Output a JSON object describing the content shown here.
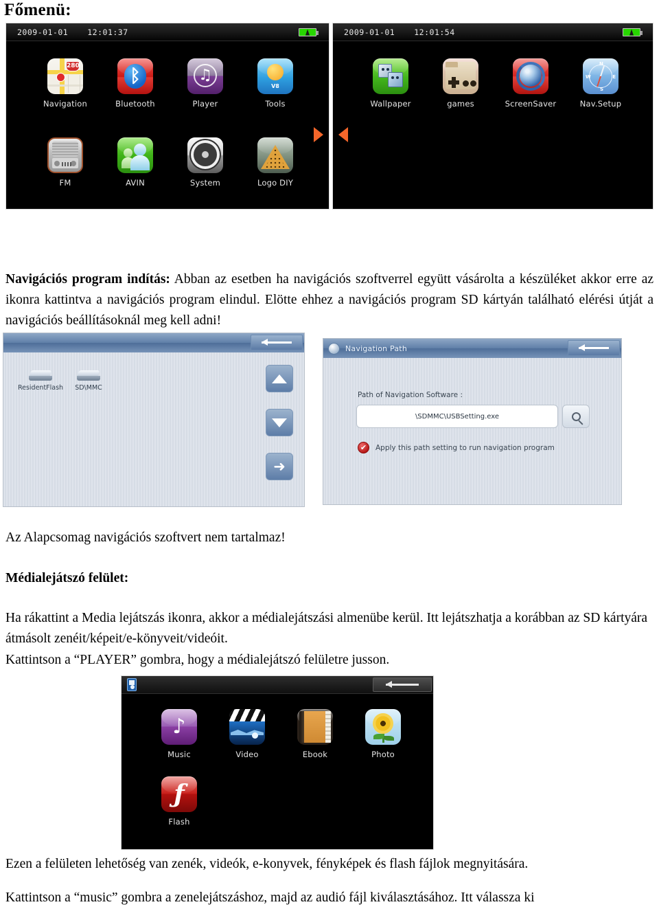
{
  "document": {
    "title": "Főmenü:"
  },
  "main_menu_page1": {
    "status": {
      "date": "2009-01-01",
      "time": "12:01:37",
      "battery_icon": "battery-charging-icon"
    },
    "icons": [
      {
        "label": "Navigation",
        "icon": "map-navigation-icon",
        "shield_number": "280"
      },
      {
        "label": "Bluetooth",
        "icon": "bluetooth-icon"
      },
      {
        "label": "Player",
        "icon": "music-player-icon"
      },
      {
        "label": "Tools",
        "icon": "tools-sun-icon",
        "badge": "V8"
      },
      {
        "label": "FM",
        "icon": "fm-radio-icon"
      },
      {
        "label": "AVIN",
        "icon": "avin-people-icon"
      },
      {
        "label": "System",
        "icon": "gear-system-icon"
      },
      {
        "label": "Logo DIY",
        "icon": "logo-diy-triangle-icon"
      }
    ],
    "next_page_arrow": "arrow-right-icon"
  },
  "main_menu_page2": {
    "status": {
      "date": "2009-01-01",
      "time": "12:01:54",
      "battery_icon": "battery-charging-icon"
    },
    "icons": [
      {
        "label": "Wallpaper",
        "icon": "wallpaper-finder-icon"
      },
      {
        "label": "games",
        "icon": "games-folder-gamepad-icon"
      },
      {
        "label": "ScreenSaver",
        "icon": "screensaver-globe-icon"
      },
      {
        "label": "Nav.Setup",
        "icon": "compass-nav-setup-icon"
      }
    ],
    "prev_page_arrow": "arrow-left-icon"
  },
  "paragraph_nav": {
    "lead": "Navigációs program indítás:",
    "body": " Abban az esetben ha navigációs szoftverrel együtt vásárolta a készüléket akkor erre az ikonra kattintva a navigációs program elindul. Elötte ehhez a navigációs program SD kártyán található elérési útját a navigációs beállításoknál meg kell adni!"
  },
  "file_browser_dialog": {
    "title": "",
    "title_icon": "path-breadcrumb-icon",
    "back_button": "back-arrow-button",
    "drives": [
      {
        "label": "ResidentFlash",
        "icon": "drive-icon"
      },
      {
        "label": "SD\\MMC",
        "icon": "drive-icon"
      }
    ],
    "buttons": [
      {
        "name": "scroll-up-button",
        "icon": "triangle-up-icon"
      },
      {
        "name": "scroll-down-button",
        "icon": "triangle-down-icon"
      },
      {
        "name": "enter-button",
        "icon": "arrow-forward-icon"
      }
    ]
  },
  "navigation_path_dialog": {
    "title": "Navigation Path",
    "title_icon": "navigation-path-icon",
    "back_button": "back-arrow-button",
    "field_label": "Path of Navigation Software :",
    "field_value": "\\SDMMC\\USBSetting.exe",
    "browse_icon": "magnifier-icon",
    "checkbox_label": "Apply this path setting to run navigation program",
    "checkbox_checked": true,
    "checkbox_mark": "✔"
  },
  "paragraph_no_nav": "Az Alapcsomag navigációs szoftvert nem tartalmaz!",
  "heading_media": "Médialejátszó felület:",
  "paragraph_media": "Ha rákattint a Media lejátszás ikonra, akkor a médialejátszási almenübe kerül. Itt lejátszhatja a korábban az SD kártyára átmásolt zenéit/képeit/e-könyveit/videóit.",
  "paragraph_player_btn": "Kattintson a “PLAYER” gombra, hogy a médialejátszó felületre jusson.",
  "media_player_screen": {
    "title_icon": "media-device-icon",
    "back_button": "back-arrow-button",
    "icons": [
      {
        "label": "Music",
        "icon": "music-note-icon"
      },
      {
        "label": "Video",
        "icon": "video-clapperboard-icon"
      },
      {
        "label": "Ebook",
        "icon": "ebook-book-icon"
      },
      {
        "label": "Photo",
        "icon": "photo-sunflower-icon"
      },
      {
        "label": "Flash",
        "icon": "flash-icon"
      }
    ]
  },
  "paragraph_bottom_1": "Ezen a felületen lehetőség van zenék, videók, e-konyvek, fényképek és flash fájlok megnyitására.",
  "paragraph_bottom_2": "Kattintson a “music” gombra a zenelejátszáshoz, majd az audió fájl kiválasztásához. Itt válassza ki",
  "colors": {
    "accent_orange": "#f4662a",
    "screen_black": "#000000",
    "dialog_blue": "#5f7fa8",
    "battery_green": "#28d600"
  }
}
